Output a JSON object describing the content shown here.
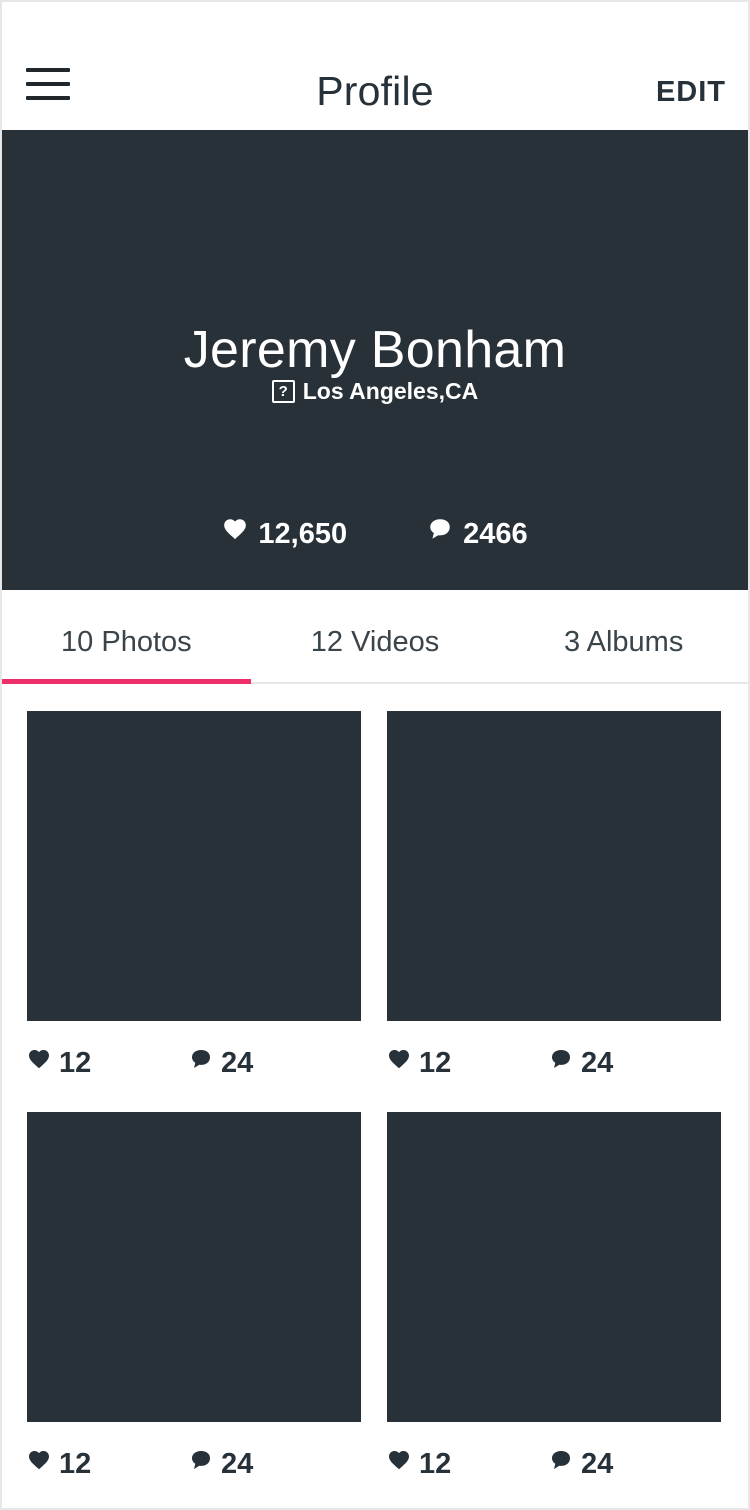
{
  "header": {
    "title": "Profile",
    "edit_label": "EDIT",
    "menu_icon": "hamburger-menu-icon"
  },
  "profile": {
    "name": "Jeremy Bonham",
    "location": "Los Angeles,CA",
    "location_icon_glyph": "?",
    "likes": "12,650",
    "comments": "2466"
  },
  "tabs": [
    {
      "label": "10 Photos",
      "active": true
    },
    {
      "label": "12 Videos",
      "active": false
    },
    {
      "label": "3 Albums",
      "active": false
    }
  ],
  "photos": [
    {
      "likes": "12",
      "comments": "24"
    },
    {
      "likes": "12",
      "comments": "24"
    },
    {
      "likes": "12",
      "comments": "24"
    },
    {
      "likes": "12",
      "comments": "24"
    }
  ],
  "colors": {
    "hero_bg": "#283138",
    "accent": "#ee2f6a",
    "text": "#263139"
  }
}
